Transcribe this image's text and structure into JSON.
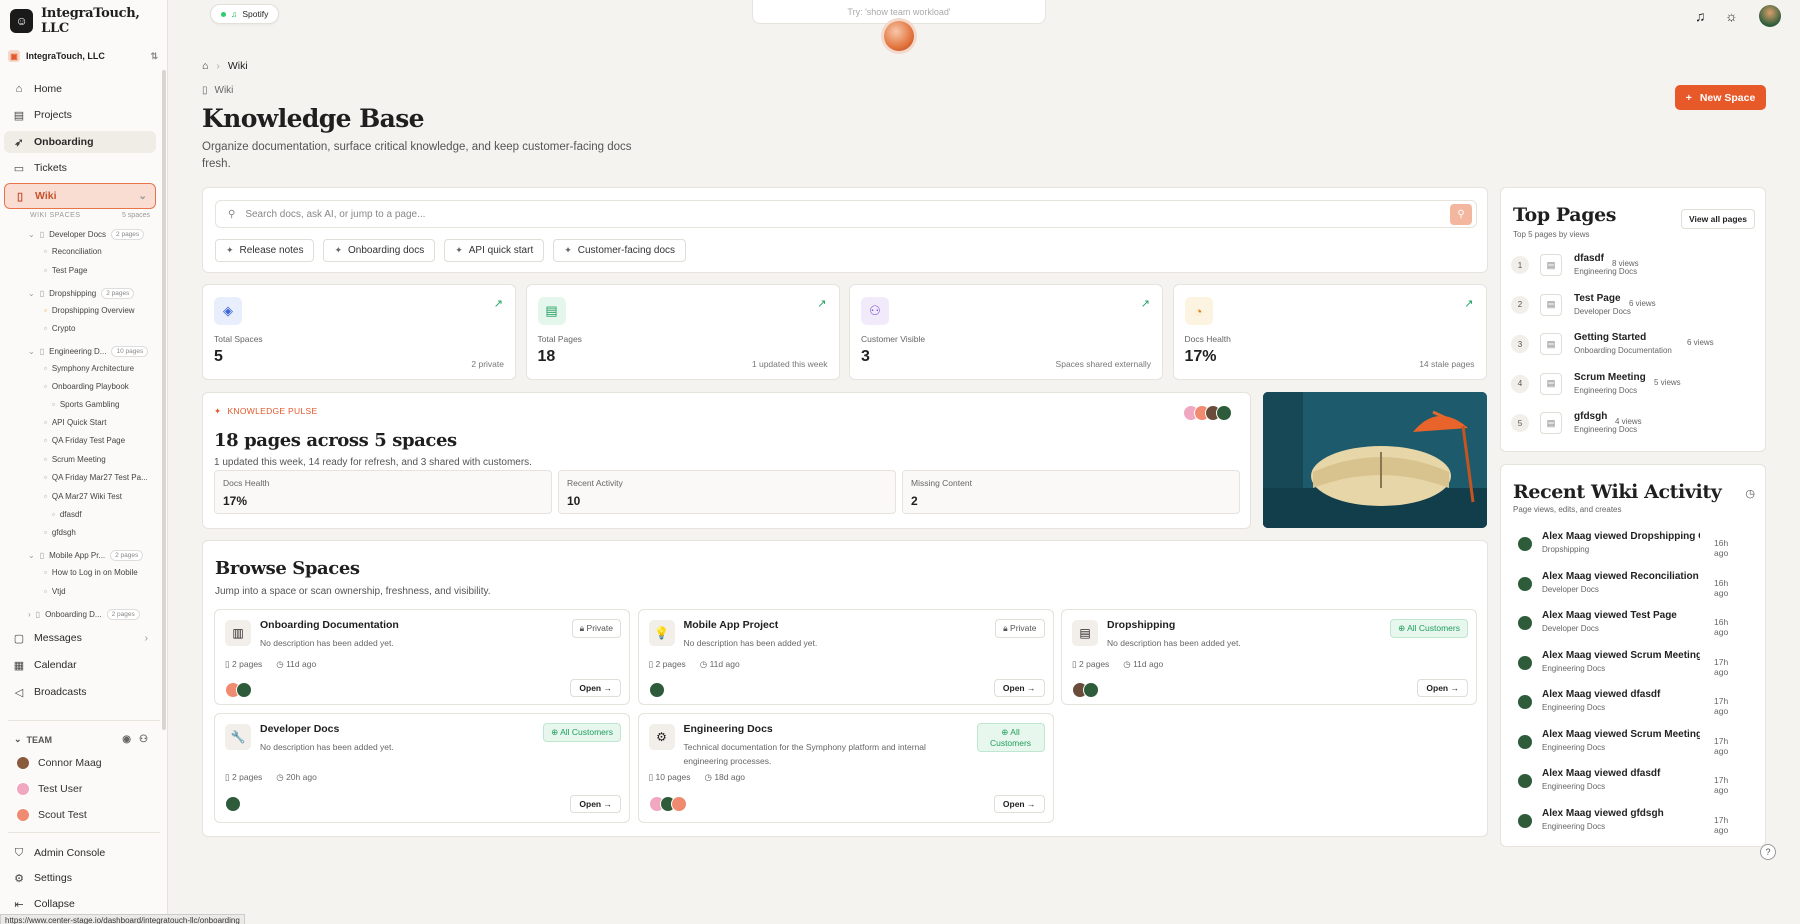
{
  "app": {
    "name": "IntegraTouch, LLC",
    "org": "IntegraTouch, LLC"
  },
  "nav": {
    "home": "Home",
    "projects": "Projects",
    "onboarding": "Onboarding",
    "tickets": "Tickets",
    "wiki": "Wiki",
    "messages": "Messages",
    "calendar": "Calendar",
    "broadcasts": "Broadcasts",
    "admin": "Admin Console",
    "settings": "Settings",
    "collapse": "Collapse"
  },
  "wiki_spaces": {
    "label": "WIKI SPACES",
    "count": "5 spaces"
  },
  "tree": [
    {
      "label": "Developer Docs",
      "badge": "2 pages"
    },
    {
      "label": "Reconciliation"
    },
    {
      "label": "Test Page"
    },
    {
      "label": "Dropshipping",
      "badge": "2 pages"
    },
    {
      "label": "Dropshipping Overview"
    },
    {
      "label": "Crypto"
    },
    {
      "label": "Engineering D...",
      "badge": "10 pages"
    },
    {
      "label": "Symphony Architecture"
    },
    {
      "label": "Onboarding Playbook"
    },
    {
      "label": "Sports Gambling"
    },
    {
      "label": "API Quick Start"
    },
    {
      "label": "QA Friday Test Page"
    },
    {
      "label": "Scrum Meeting"
    },
    {
      "label": "QA Friday Mar27 Test Pa..."
    },
    {
      "label": "QA Mar27 Wiki Test"
    },
    {
      "label": "dfasdf"
    },
    {
      "label": "gfdsgh"
    },
    {
      "label": "Mobile App Pr...",
      "badge": "2 pages"
    },
    {
      "label": "How to Log in on Mobile"
    },
    {
      "label": "Vtjd"
    },
    {
      "label": "Onboarding D...",
      "badge": "2 pages"
    }
  ],
  "team": {
    "label": "TEAM",
    "members": [
      "Connor Maag",
      "Test User",
      "Scout Test"
    ]
  },
  "status_url": "https://www.center-stage.io/dashboard/integratouch-llc/onboarding",
  "topbar": {
    "spotify": "Spotify",
    "command_placeholder": "Try: 'show team workload'"
  },
  "breadcrumb": {
    "current": "Wiki"
  },
  "header": {
    "section": "Wiki",
    "title": "Knowledge Base",
    "subtitle": "Organize documentation, surface critical knowledge, and keep customer-facing docs fresh.",
    "new_space": "New Space"
  },
  "search": {
    "placeholder": "Search docs, ask AI, or jump to a page...",
    "pills": [
      "Release notes",
      "Onboarding docs",
      "API quick start",
      "Customer-facing docs"
    ]
  },
  "stats": [
    {
      "label": "Total Spaces",
      "value": "5",
      "foot": "2 private",
      "color": "#e8eefc",
      "icon": "layers-icon"
    },
    {
      "label": "Total Pages",
      "value": "18",
      "foot": "1 updated this week",
      "color": "#e5f6ec",
      "icon": "file-icon"
    },
    {
      "label": "Customer Visible",
      "value": "3",
      "foot": "Spaces shared externally",
      "color": "#f1eafb",
      "icon": "users-icon"
    },
    {
      "label": "Docs Health",
      "value": "17%",
      "foot": "14 stale pages",
      "color": "#fdf3e1",
      "icon": "gauge-icon"
    }
  ],
  "pulse": {
    "tag": "KNOWLEDGE PULSE",
    "title": "18 pages across 5 spaces",
    "subtitle": "1 updated this week, 14 ready for refresh, and 3 shared with customers.",
    "minis": [
      {
        "label": "Docs Health",
        "value": "17%"
      },
      {
        "label": "Recent Activity",
        "value": "10"
      },
      {
        "label": "Missing Content",
        "value": "2"
      }
    ]
  },
  "browse": {
    "title": "Browse Spaces",
    "subtitle": "Jump into a space or scan ownership, freshness, and visibility.",
    "open_label": "Open",
    "spaces": [
      {
        "name": "Onboarding Documentation",
        "desc": "No description has been added yet.",
        "pages": "2 pages",
        "age": "11d ago",
        "tag": "Private",
        "public": false,
        "icon": "books-icon"
      },
      {
        "name": "Mobile App Project",
        "desc": "No description has been added yet.",
        "pages": "2 pages",
        "age": "11d ago",
        "tag": "Private",
        "public": false,
        "icon": "bulb-icon"
      },
      {
        "name": "Dropshipping",
        "desc": "No description has been added yet.",
        "pages": "2 pages",
        "age": "11d ago",
        "tag": "All Customers",
        "public": true,
        "icon": "notebook-icon"
      },
      {
        "name": "Developer Docs",
        "desc": "No description has been added yet.",
        "pages": "2 pages",
        "age": "20h ago",
        "tag": "All Customers",
        "public": true,
        "icon": "wrench-icon"
      },
      {
        "name": "Engineering Docs",
        "desc": "Technical documentation for the Symphony platform and internal engineering processes.",
        "pages": "10 pages",
        "age": "18d ago",
        "tag": "All Customers",
        "public": true,
        "icon": "gear-icon"
      }
    ]
  },
  "top_pages": {
    "title": "Top Pages",
    "subtitle": "Top 5 pages by views",
    "view_all": "View all pages",
    "items": [
      {
        "rank": "1",
        "title": "dfasdf",
        "space": "Engineering Docs",
        "views": "8 views"
      },
      {
        "rank": "2",
        "title": "Test Page",
        "space": "Developer Docs",
        "views": "6 views"
      },
      {
        "rank": "3",
        "title": "Getting Started",
        "space": "Onboarding Documentation",
        "views": "6 views"
      },
      {
        "rank": "4",
        "title": "Scrum Meeting",
        "space": "Engineering Docs",
        "views": "5 views"
      },
      {
        "rank": "5",
        "title": "gfdsgh",
        "space": "Engineering Docs",
        "views": "4 views"
      }
    ]
  },
  "recent": {
    "title": "Recent Wiki Activity",
    "subtitle": "Page views, edits, and creates",
    "items": [
      {
        "text": "Alex Maag viewed Dropshipping Ov...",
        "space": "Dropshipping",
        "time": "16h ago"
      },
      {
        "text": "Alex Maag viewed Reconciliation",
        "space": "Developer Docs",
        "time": "16h ago"
      },
      {
        "text": "Alex Maag viewed Test Page",
        "space": "Developer Docs",
        "time": "16h ago"
      },
      {
        "text": "Alex Maag viewed Scrum Meeting",
        "space": "Engineering Docs",
        "time": "17h ago"
      },
      {
        "text": "Alex Maag viewed dfasdf",
        "space": "Engineering Docs",
        "time": "17h ago"
      },
      {
        "text": "Alex Maag viewed Scrum Meeting",
        "space": "Engineering Docs",
        "time": "17h ago"
      },
      {
        "text": "Alex Maag viewed dfasdf",
        "space": "Engineering Docs",
        "time": "17h ago"
      },
      {
        "text": "Alex Maag viewed gfdsgh",
        "space": "Engineering Docs",
        "time": "17h ago"
      }
    ]
  },
  "colors": {
    "accent": "#e8592a",
    "success": "#20a366"
  }
}
